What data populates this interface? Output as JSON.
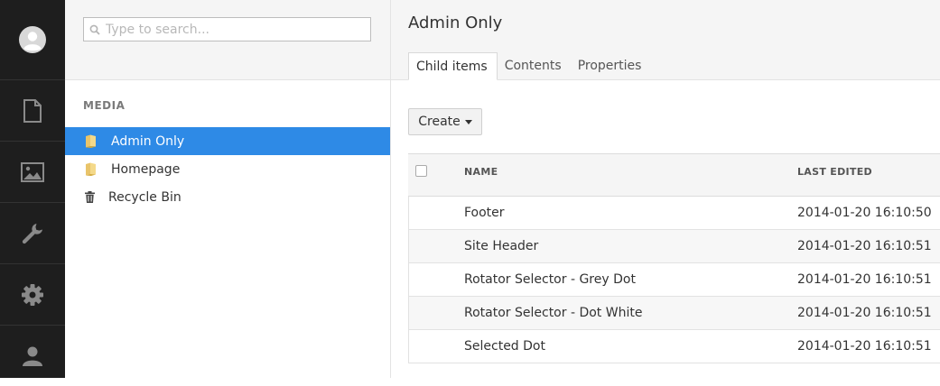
{
  "appbar": {
    "sections": [
      {
        "icon": "document-icon"
      },
      {
        "icon": "image-icon"
      },
      {
        "icon": "wrench-icon"
      },
      {
        "icon": "gear-icon"
      },
      {
        "icon": "user-icon"
      }
    ]
  },
  "tree": {
    "search": {
      "placeholder": "Type to search..."
    },
    "section_title": "MEDIA",
    "nodes": [
      {
        "label": "Admin Only",
        "icon": "folder-icon",
        "selected": true
      },
      {
        "label": "Homepage",
        "icon": "folder-icon",
        "selected": false
      },
      {
        "label": "Recycle Bin",
        "icon": "trash-icon",
        "selected": false
      }
    ]
  },
  "main": {
    "title": "Admin Only",
    "tabs": [
      {
        "label": "Child items",
        "active": true
      },
      {
        "label": "Contents",
        "active": false
      },
      {
        "label": "Properties",
        "active": false
      }
    ],
    "create_label": "Create",
    "grid": {
      "columns": {
        "name": "NAME",
        "last_edited": "LAST EDITED"
      },
      "rows": [
        {
          "name": "Footer",
          "last_edited": "2014-01-20 16:10:50"
        },
        {
          "name": "Site Header",
          "last_edited": "2014-01-20 16:10:51"
        },
        {
          "name": "Rotator Selector - Grey Dot",
          "last_edited": "2014-01-20 16:10:51"
        },
        {
          "name": "Rotator Selector - Dot White",
          "last_edited": "2014-01-20 16:10:51"
        },
        {
          "name": "Selected Dot",
          "last_edited": "2014-01-20 16:10:51"
        }
      ]
    }
  },
  "colors": {
    "appbar_bg": "#1e1e1e",
    "selected_bg": "#2e8ae6",
    "panel_bg": "#f5f5f5"
  }
}
